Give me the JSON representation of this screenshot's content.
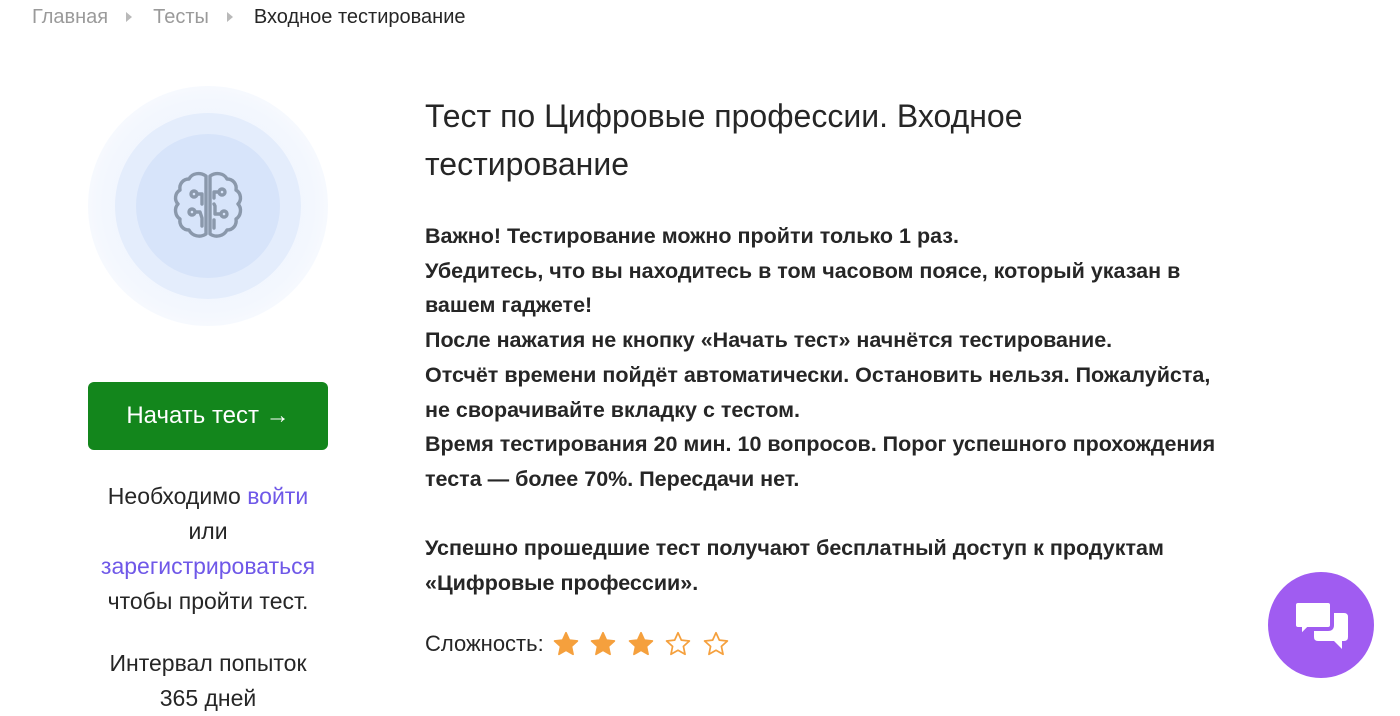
{
  "breadcrumb": {
    "items": [
      "Главная",
      "Тесты"
    ],
    "current": "Входное тестирование"
  },
  "sidebar": {
    "icon": "brain-icon",
    "start_button_label": "Начать тест →",
    "auth": {
      "prefix": "Необходимо",
      "login_link": "войти",
      "or": "или",
      "register_link": "зарегистрироваться",
      "suffix": "чтобы пройти тест."
    },
    "interval": {
      "label": "Интервал попыток",
      "value": "365 дней"
    }
  },
  "main": {
    "title": "Тест по Цифровые профессии. Входное тестирование",
    "description_lines": [
      "Важно! Тестирование можно пройти только 1 раз.",
      "Убедитесь, что вы находитесь в том часовом поясе, который указан в",
      "вашем гаджете!",
      "После нажатия не кнопку «Начать тест» начнётся тестирование.",
      "Отсчёт времени пойдёт автоматически. Остановить нельзя. Пожалуйста,",
      "не сворачивайте вкладку с тестом.",
      "Время тестирования 20 мин. 10 вопросов. Порог успешного прохождения",
      "теста — более 70%. Пересдачи нет."
    ],
    "benefit_lines": [
      "Успешно прошедшие тест получают бесплатный доступ к продуктам",
      "«Цифровые профессии»."
    ],
    "difficulty": {
      "label": "Сложность:",
      "rating": 3,
      "max": 5
    }
  },
  "chat_widget": {
    "icon": "chat-bubbles-icon"
  },
  "colors": {
    "primary_button": "#13861c",
    "link": "#6f58e8",
    "star": "#f5a03d",
    "chat": "#a05cf1",
    "icon": "#8a98ab"
  }
}
